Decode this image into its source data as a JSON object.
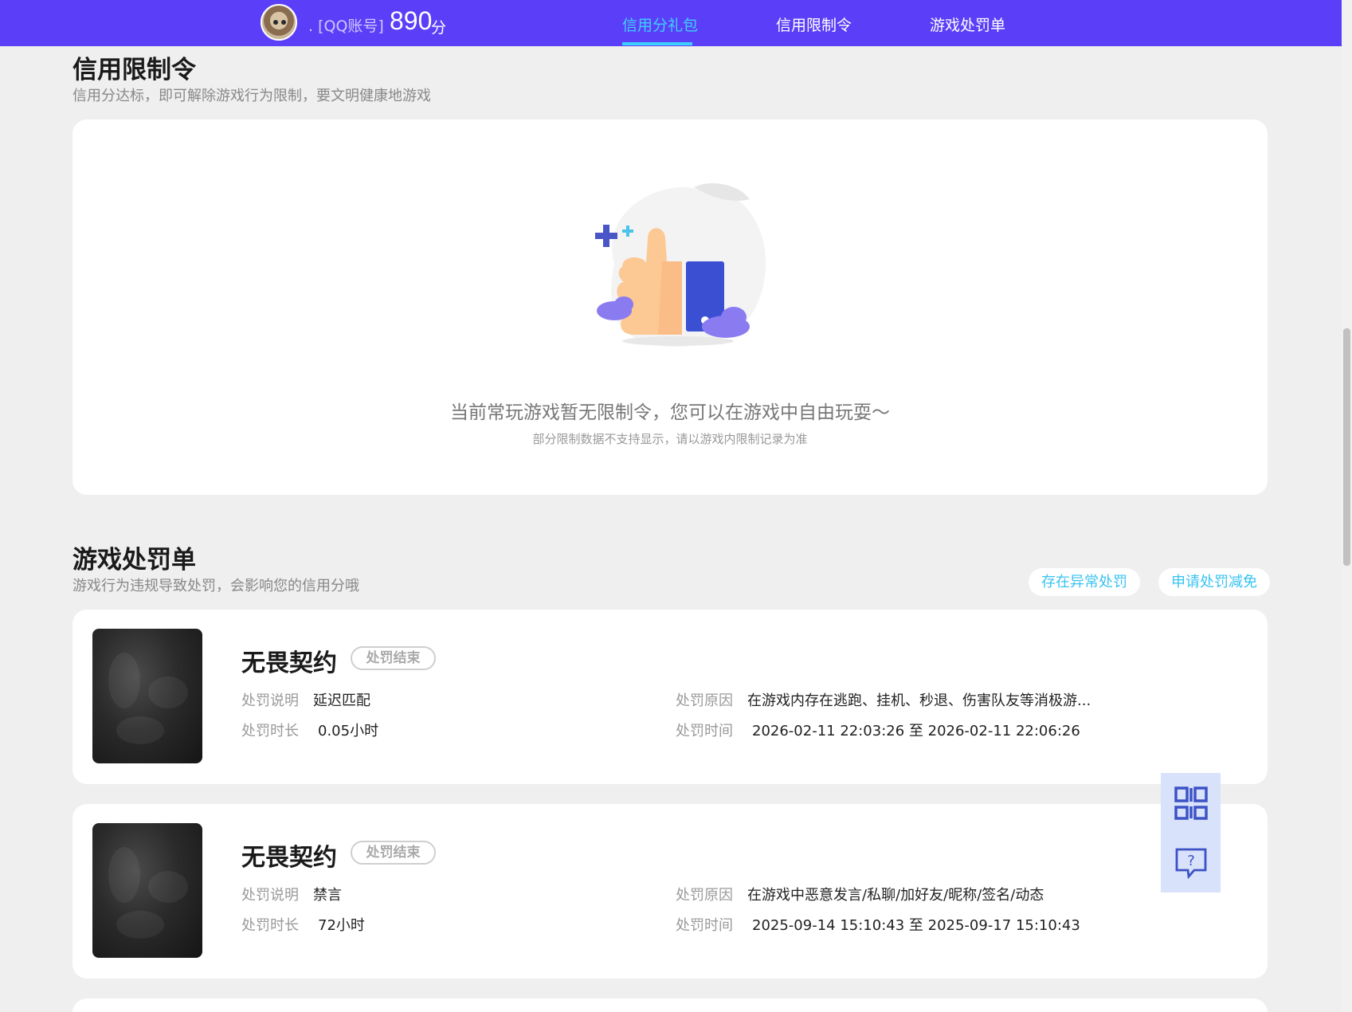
{
  "header": {
    "account_label": ". [QQ账号]",
    "score": "890",
    "score_unit": "分",
    "tabs": [
      {
        "label": "信用分礼包",
        "active": true
      },
      {
        "label": "信用限制令",
        "active": false
      },
      {
        "label": "游戏处罚单",
        "active": false
      }
    ]
  },
  "restrictions": {
    "title": "信用限制令",
    "subtitle": "信用分达标，即可解除游戏行为限制，要文明健康地游戏",
    "empty_title": "当前常玩游戏暂无限制令，您可以在游戏中自由玩耍～",
    "empty_note": "部分限制数据不支持显示，请以游戏内限制记录为准"
  },
  "penalties": {
    "title": "游戏处罚单",
    "subtitle": "游戏行为违规导致处罚，会影响您的信用分哦",
    "actions": {
      "abnormal": "存在异常处罚",
      "appeal": "申请处罚减免"
    },
    "labels": {
      "desc": "处罚说明",
      "duration": "处罚时长",
      "reason": "处罚原因",
      "time": "处罚时间"
    },
    "items": [
      {
        "game": "无畏契约",
        "status": "处罚结束",
        "desc": "延迟匹配",
        "duration": "0.05小时",
        "reason": "在游戏内存在逃跑、挂机、秒退、伤害队友等消极游...",
        "time": "2026-02-11 22:03:26 至 2026-02-11 22:06:26"
      },
      {
        "game": "无畏契约",
        "status": "处罚结束",
        "desc": "禁言",
        "duration": "72小时",
        "reason": "在游戏中恶意发言/私聊/加好友/昵称/签名/动态",
        "time": "2025-09-14 15:10:43 至 2025-09-17 15:10:43"
      }
    ]
  },
  "floating": {
    "qr_icon": "qr-code-icon",
    "help_icon": "help-chat-icon"
  },
  "colors": {
    "brand": "#5b3ff8",
    "accent": "#3dd0ff",
    "page_bg": "#efefef"
  }
}
